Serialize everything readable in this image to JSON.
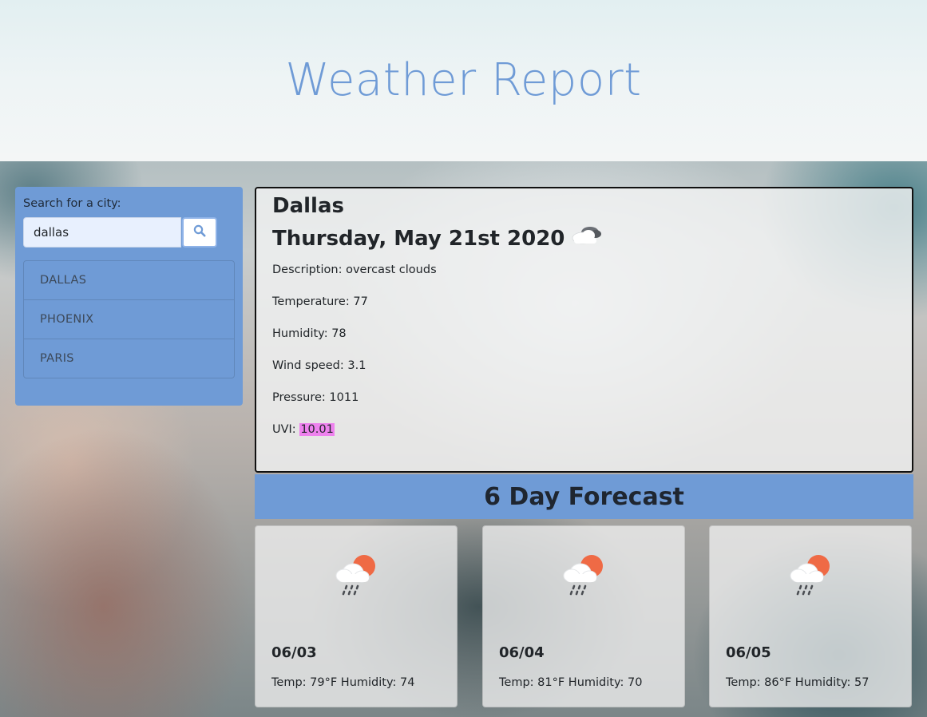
{
  "header": {
    "title": "Weather Report"
  },
  "sidebar": {
    "label": "Search for a city:",
    "search_value": "dallas",
    "search_icon": "search-icon",
    "cities": [
      "DALLAS",
      "PHOENIX",
      "PARIS"
    ]
  },
  "current": {
    "city": "Dallas",
    "date": "Thursday, May 21st 2020",
    "icon": "cloudy-icon",
    "description_label": "Description:",
    "description": "overcast clouds",
    "temperature_label": "Temperature:",
    "temperature": "77",
    "humidity_label": "Humidity:",
    "humidity": "78",
    "wind_label": "Wind speed:",
    "wind": "3.1",
    "pressure_label": "Pressure:",
    "pressure": "1011",
    "uvi_label": "UVI:",
    "uvi": "10.01",
    "uvi_color": "#ee82ee"
  },
  "forecast": {
    "title": "6 Day Forecast",
    "days": [
      {
        "date": "06/03",
        "info": "Temp: 79°F Humidity: 74",
        "icon": "sun-rain-icon"
      },
      {
        "date": "06/04",
        "info": "Temp: 81°F Humidity: 70",
        "icon": "sun-rain-icon"
      },
      {
        "date": "06/05",
        "info": "Temp: 86°F Humidity: 57",
        "icon": "sun-rain-icon"
      }
    ]
  },
  "colors": {
    "accent": "#6f9bd6",
    "title": "#6f9bd6"
  }
}
